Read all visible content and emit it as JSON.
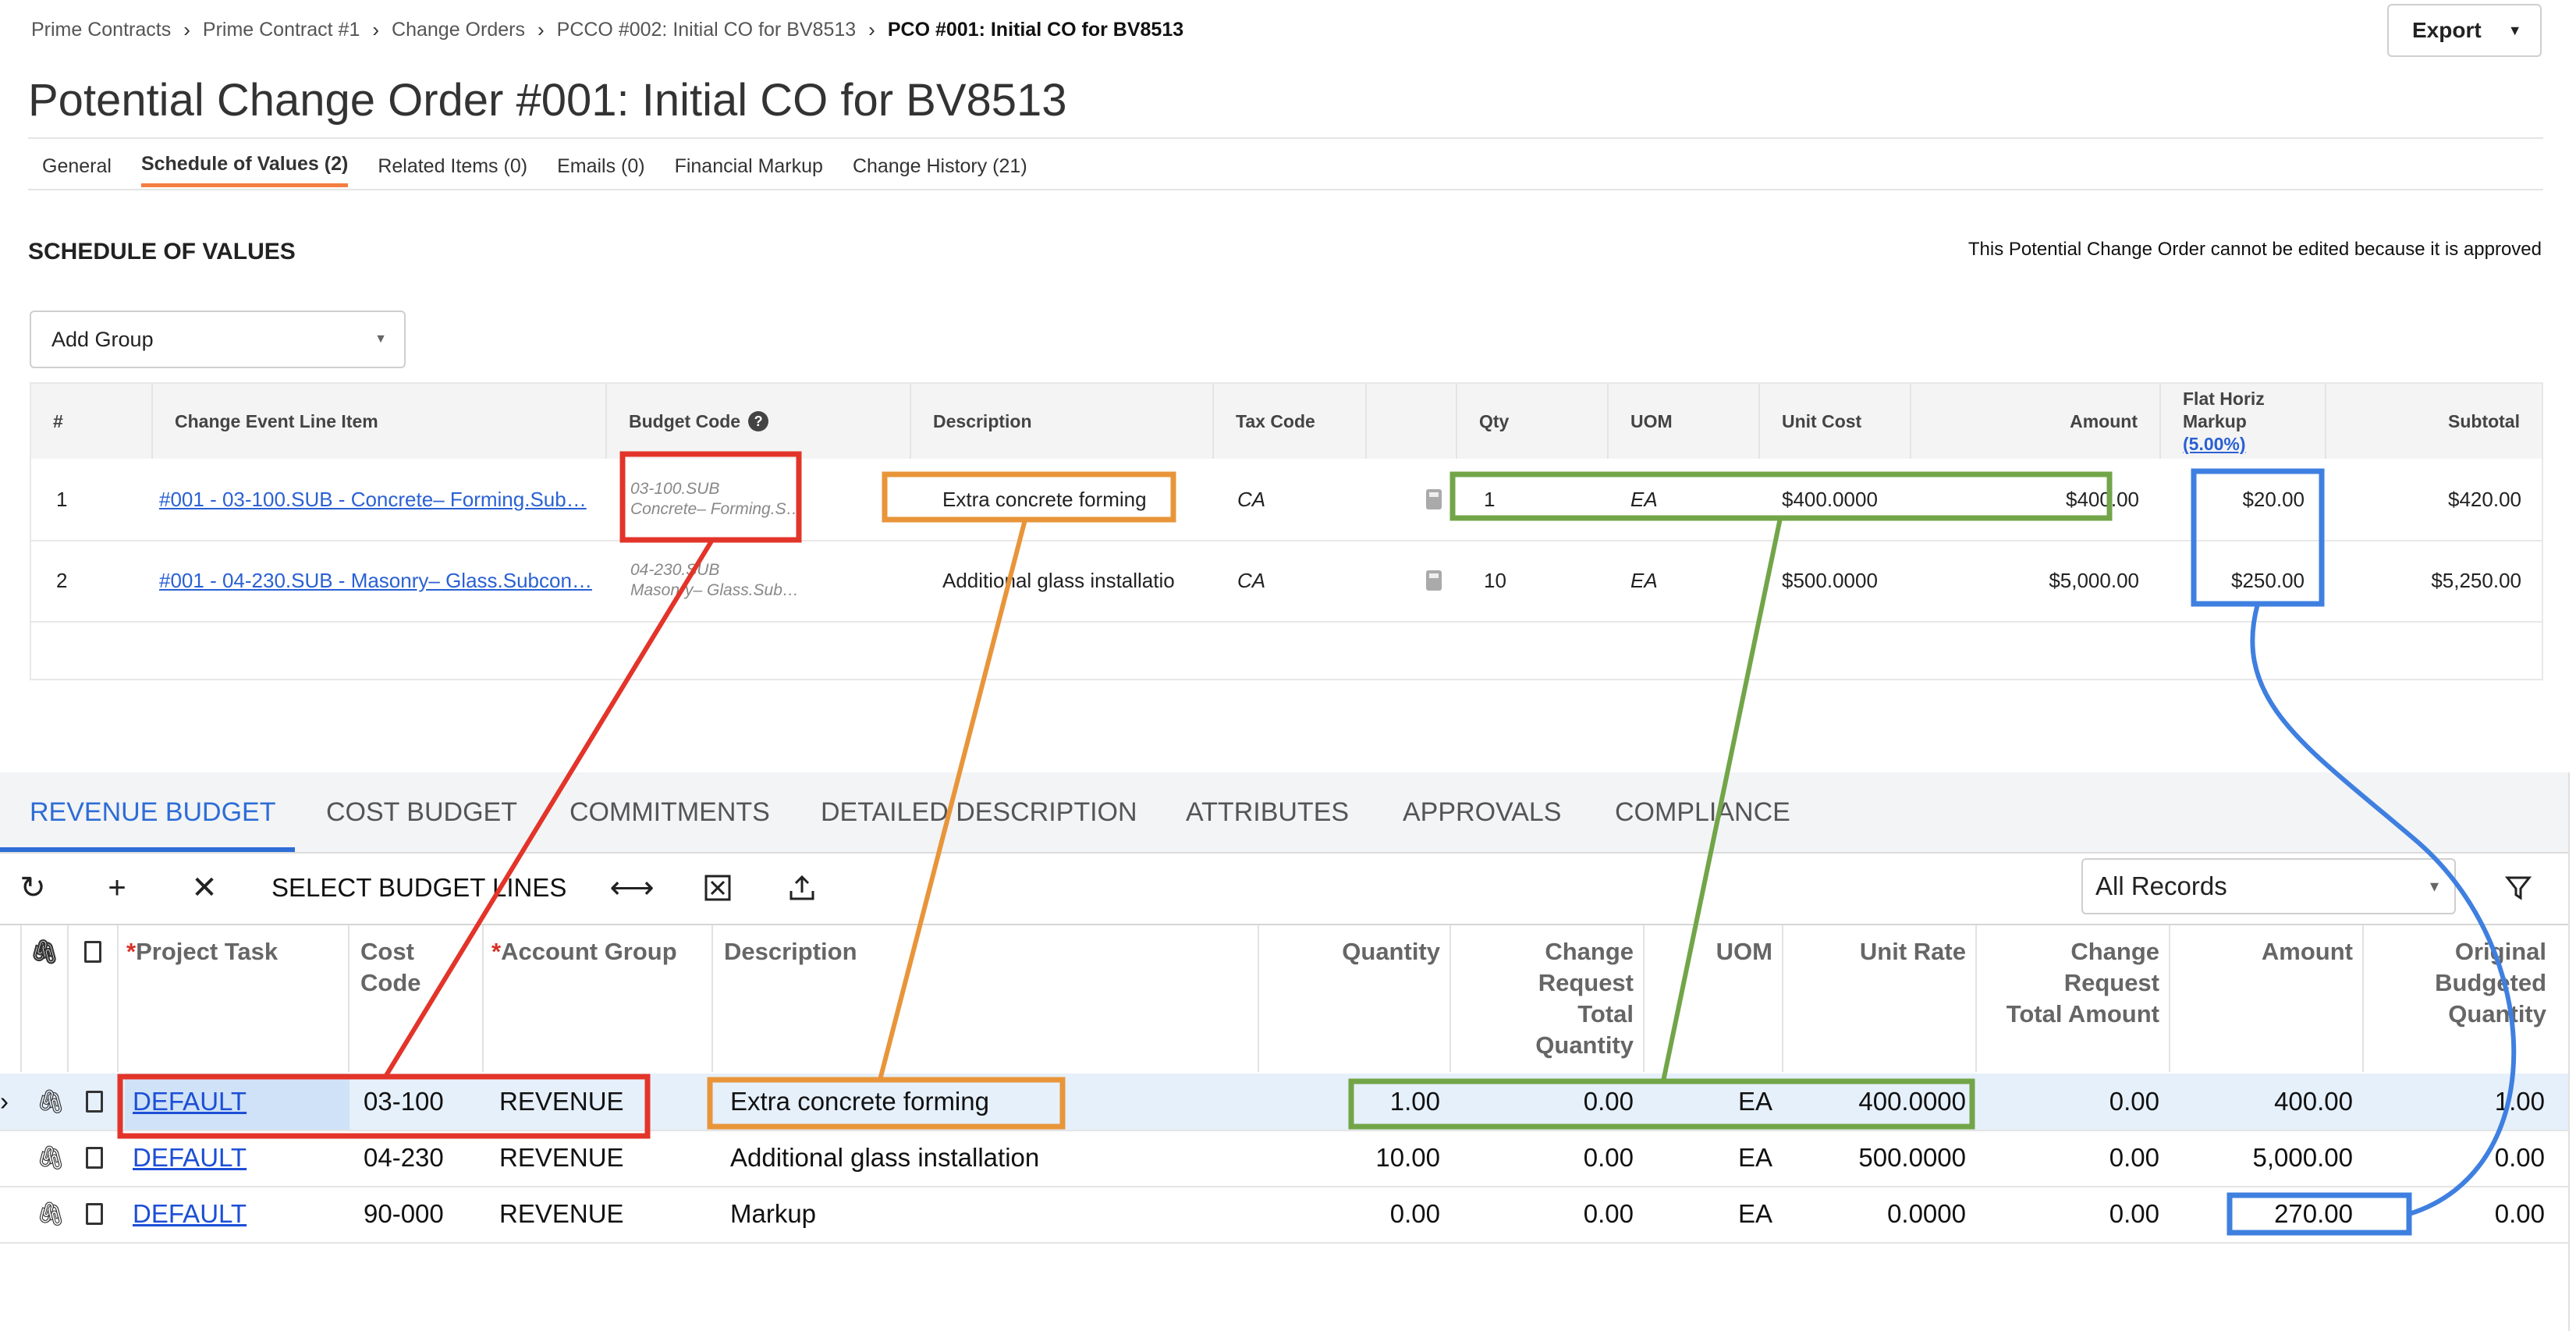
{
  "breadcrumbs": [
    "Prime Contracts",
    "Prime Contract #1",
    "Change Orders",
    "PCCO #002: Initial CO for BV8513",
    "PCO #001: Initial CO for BV8513"
  ],
  "export_label": "Export",
  "page_title": "Potential Change Order #001: Initial CO for BV8513",
  "tabs": [
    "General",
    "Schedule of Values (2)",
    "Related Items (0)",
    "Emails (0)",
    "Financial Markup",
    "Change History (21)"
  ],
  "sov": {
    "heading": "SCHEDULE OF VALUES",
    "note": "This Potential Change Order cannot be edited because it is approved",
    "add_group": "Add Group",
    "columns": {
      "num": "#",
      "line_item": "Change Event Line Item",
      "budget_code": "Budget Code",
      "description": "Description",
      "tax_code": "Tax Code",
      "qty": "Qty",
      "uom": "UOM",
      "unit_cost": "Unit Cost",
      "amount": "Amount",
      "markup_1": "Flat Horiz",
      "markup_2": "Markup",
      "markup_pct": "(5.00%)",
      "subtotal": "Subtotal"
    },
    "rows": [
      {
        "num": "1",
        "line_item": "#001 - 03-100.SUB - Concrete– Forming.Sub…",
        "budget_code_1": "03-100.SUB",
        "budget_code_2": "Concrete– Forming.S…",
        "description": "Extra concrete forming",
        "tax_code": "CA",
        "qty": "1",
        "uom": "EA",
        "unit_cost": "$400.0000",
        "amount": "$400.00",
        "markup": "$20.00",
        "subtotal": "$420.00"
      },
      {
        "num": "2",
        "line_item": "#001 - 04-230.SUB - Masonry– Glass.Subcon…",
        "budget_code_1": "04-230.SUB",
        "budget_code_2": "Masonry– Glass.Sub…",
        "description": "Additional glass installatio",
        "tax_code": "CA",
        "qty": "10",
        "uom": "EA",
        "unit_cost": "$500.0000",
        "amount": "$5,000.00",
        "markup": "$250.00",
        "subtotal": "$5,250.00"
      }
    ]
  },
  "acumatica": {
    "tabs": [
      "REVENUE BUDGET",
      "COST BUDGET",
      "COMMITMENTS",
      "DETAILED DESCRIPTION",
      "ATTRIBUTES",
      "APPROVALS",
      "COMPLIANCE"
    ],
    "active_tab": "REVENUE BUDGET",
    "toolbar": {
      "select_budget_lines": "SELECT BUDGET LINES",
      "filter_value": "All Records"
    },
    "columns": {
      "project_task": "Project Task",
      "cost_code_1": "Cost",
      "cost_code_2": "Code",
      "account_group": "Account Group",
      "description": "Description",
      "quantity": "Quantity",
      "crtq_1": "Change",
      "crtq_2": "Request",
      "crtq_3": "Total",
      "crtq_4": "Quantity",
      "uom": "UOM",
      "unit_rate": "Unit Rate",
      "crta_1": "Change",
      "crta_2": "Request",
      "crta_3": "Total Amount",
      "amount": "Amount",
      "obq_1": "Original",
      "obq_2": "Budgeted",
      "obq_3": "Quantity"
    },
    "rows": [
      {
        "task": "DEFAULT",
        "cost_code": "03-100",
        "account_group": "REVENUE",
        "description": "Extra concrete forming",
        "quantity": "1.00",
        "cr_total_qty": "0.00",
        "uom": "EA",
        "unit_rate": "400.0000",
        "cr_total_amount": "0.00",
        "amount": "400.00",
        "orig_budget_qty": "1.00"
      },
      {
        "task": "DEFAULT",
        "cost_code": "04-230",
        "account_group": "REVENUE",
        "description": "Additional glass installation",
        "quantity": "10.00",
        "cr_total_qty": "0.00",
        "uom": "EA",
        "unit_rate": "500.0000",
        "cr_total_amount": "0.00",
        "amount": "5,000.00",
        "orig_budget_qty": "0.00"
      },
      {
        "task": "DEFAULT",
        "cost_code": "90-000",
        "account_group": "REVENUE",
        "description": "Markup",
        "quantity": "0.00",
        "cr_total_qty": "0.00",
        "uom": "EA",
        "unit_rate": "0.0000",
        "cr_total_amount": "0.00",
        "amount": "270.00",
        "orig_budget_qty": "0.00"
      }
    ]
  },
  "annotation_colors": {
    "budget_code": "#e3342a",
    "description": "#e8953a",
    "quantities": "#72a548",
    "markup": "#3f7fe0"
  }
}
